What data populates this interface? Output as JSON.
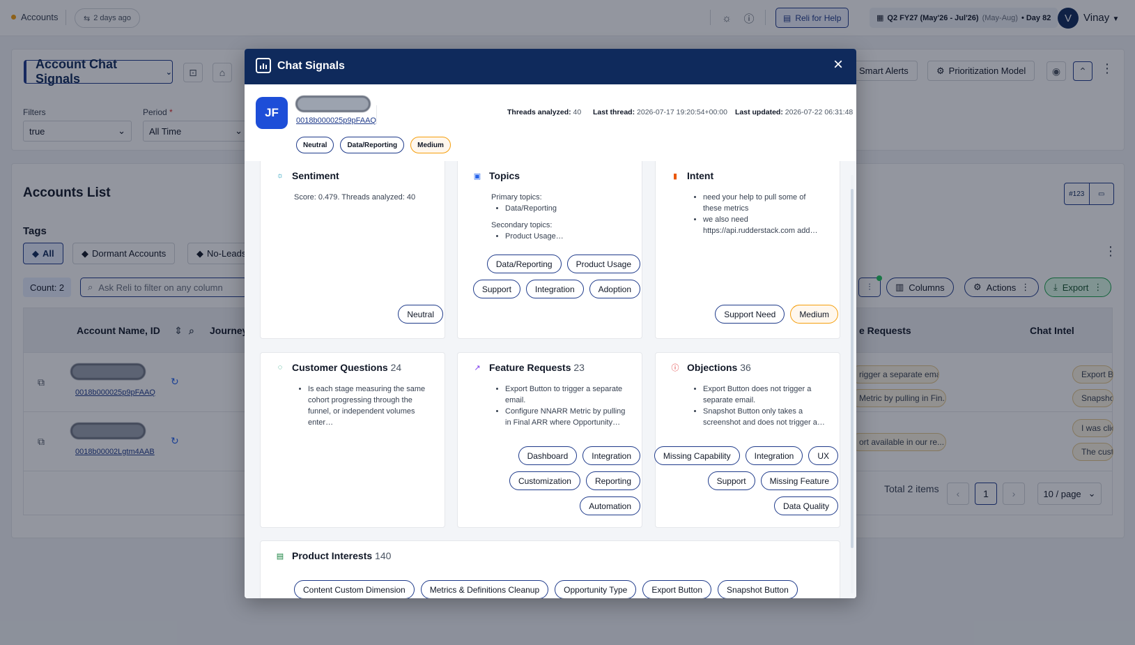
{
  "topbar": {
    "accounts": "Accounts",
    "last_sync": "2 days ago",
    "help_button": "Reli for Help",
    "quarter": "Q2 FY27 (May'26 - Jul'26)",
    "quarter_months": "(May-Aug)",
    "day": "• Day 82",
    "avatar_initial": "V",
    "user_name": "Vinay"
  },
  "view": {
    "name": "Account Chat Signals",
    "filters_label": "Filters",
    "filters_value": "true",
    "period_label": "Period",
    "period_value": "All Time",
    "smart_alerts": "Smart Alerts",
    "prioritization_model": "Prioritization Model"
  },
  "accounts_list": {
    "title": "Accounts List",
    "tags_label": "Tags",
    "tags": [
      "All",
      "Dormant Accounts",
      "No-Leads"
    ],
    "count": "Count: 2",
    "ask_placeholder": "Ask Reli to filter on any column",
    "columns_btn": "Columns",
    "actions_btn": "Actions",
    "export_btn": "Export",
    "mini_label": "#123",
    "headers": {
      "account": "Account Name, ID",
      "journey": "Journey",
      "feature_requests": "e Requests",
      "chat_intel": "Chat Intel"
    },
    "rows": [
      {
        "id": "0018b000025p9pFAAQ",
        "req1": "rigger a separate emai...",
        "req2": "Metric by pulling in Fin...",
        "intel1": "Export B",
        "intel2": "Snapsho"
      },
      {
        "id": "0018b00002Lgtm4AAB",
        "req1": "ort available in our re...",
        "intel1": "I was clic",
        "intel2": "The cust"
      }
    ],
    "total": "Total 2 items",
    "page": "1",
    "per_page": "10 / page"
  },
  "modal": {
    "title": "Chat Signals",
    "avatar": "JF",
    "account_id": "0018b000025p9pFAAQ",
    "threads_label": "Threads analyzed:",
    "threads_value": "40",
    "last_thread_label": "Last thread:",
    "last_thread_value": "2026-07-17 19:20:54+00:00",
    "last_updated_label": "Last updated:",
    "last_updated_value": "2026-07-22 06:31:48",
    "badges": [
      "Neutral",
      "Data/Reporting",
      "Medium"
    ],
    "sentiment": {
      "title": "Sentiment",
      "text": "Score: 0.479. Threads analyzed: 40",
      "chips": [
        "Neutral"
      ]
    },
    "topics": {
      "title": "Topics",
      "primary_label": "Primary topics:",
      "primary": [
        "Data/Reporting"
      ],
      "secondary_label": "Secondary topics:",
      "secondary": [
        "Product Usage…"
      ],
      "chips": [
        "Data/Reporting",
        "Product Usage",
        "Support",
        "Integration",
        "Adoption"
      ]
    },
    "intent": {
      "title": "Intent",
      "items": [
        "need your help to pull some of these metrics",
        "we also need https://api.rudderstack.com add…"
      ],
      "chips": [
        "Support Need",
        "Medium"
      ]
    },
    "questions": {
      "title": "Customer Questions",
      "count": "24",
      "items": [
        "Is each stage measuring the same cohort progressing through the funnel, or independent volumes enter…"
      ]
    },
    "feature_requests": {
      "title": "Feature Requests",
      "count": "23",
      "items": [
        "Export Button to trigger a separate email.",
        "Configure NNARR Metric by pulling in Final ARR where Opportunity…"
      ],
      "chips": [
        "Dashboard",
        "Integration",
        "Customization",
        "Reporting",
        "Automation"
      ]
    },
    "objections": {
      "title": "Objections",
      "count": "36",
      "items": [
        "Export Button does not trigger a separate email.",
        "Snapshot Button only takes a screenshot and does not trigger a…"
      ],
      "chips": [
        "Missing Capability",
        "Integration",
        "UX",
        "Support",
        "Missing Feature",
        "Data Quality"
      ]
    },
    "product_interests": {
      "title": "Product Interests",
      "count": "140",
      "chips": [
        "Content Custom Dimension",
        "Metrics & Definitions Cleanup",
        "Opportunity Type",
        "Export Button",
        "Snapshot Button"
      ]
    }
  },
  "colors": {
    "brand_navy": "#0f2a5c",
    "accent_orange": "#f59e0b",
    "export_green": "#16a34a"
  }
}
